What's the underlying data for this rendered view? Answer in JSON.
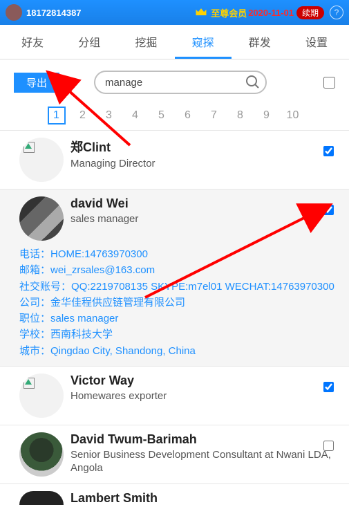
{
  "header": {
    "uid": "18172814387",
    "vip_label": "至尊会员",
    "expiry": "2020-11-01",
    "renew_label": "续期"
  },
  "tabs": [
    {
      "label": "好友"
    },
    {
      "label": "分组"
    },
    {
      "label": "挖掘"
    },
    {
      "label": "窥探",
      "active": true
    },
    {
      "label": "群发"
    },
    {
      "label": "设置"
    }
  ],
  "toolbar": {
    "export_label": "导出",
    "search_value": "manage"
  },
  "pagination": {
    "pages": [
      "1",
      "2",
      "3",
      "4",
      "5",
      "6",
      "7",
      "8",
      "9",
      "10"
    ],
    "active": 1
  },
  "contacts": [
    {
      "name": "郑Clint",
      "title": "Managing Director",
      "avatar": "broken",
      "checked": true
    },
    {
      "name": "david Wei",
      "title": "sales manager",
      "avatar": "photo1",
      "checked": true,
      "expanded": true,
      "details": [
        "电话：HOME:14763970300",
        "邮箱：wei_zrsales@163.com",
        "社交账号：QQ:2219708135 SKYPE:m7el01 WECHAT:14763970300",
        "公司：金华佳程供应链管理有限公司",
        "职位：sales manager",
        "学校：西南科技大学",
        "城市：Qingdao City, Shandong, China"
      ]
    },
    {
      "name": "Victor Way",
      "title": "Homewares exporter",
      "avatar": "broken",
      "checked": true
    },
    {
      "name": "David Twum-Barimah",
      "title": "Senior Business Development Consultant at Nwani LDA, Angola",
      "avatar": "photo2",
      "checked": false
    },
    {
      "name": "Lambert Smith",
      "title": "",
      "avatar": "photo3",
      "checked": false
    }
  ]
}
